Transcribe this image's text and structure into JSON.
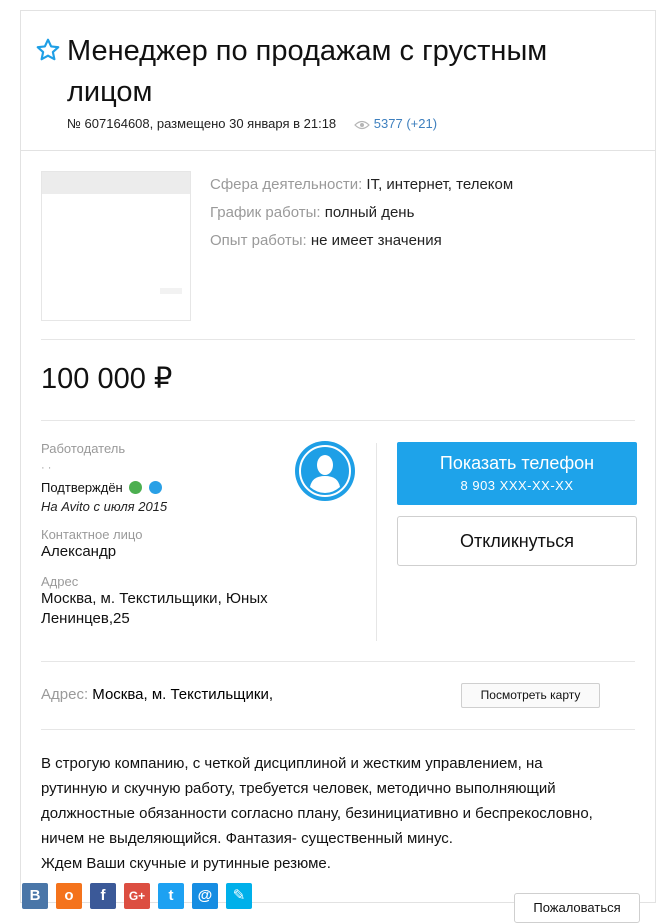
{
  "listing": {
    "title": "Менеджер по продажам с грустным лицом",
    "meta": "№ 607164608, размещено 30 января в 21:18",
    "views": "5377 (+21)"
  },
  "details": [
    {
      "label": "Сфера деятельности:",
      "value": "IT, интернет, телеком"
    },
    {
      "label": "График работы:",
      "value": "полный день"
    },
    {
      "label": "Опыт работы:",
      "value": "не имеет значения"
    }
  ],
  "price": "100 000 ₽",
  "seller": {
    "employer_label": "Работодатель",
    "confirmed": "Подтверждён",
    "since": "На Avito с июля 2015",
    "contact_label": "Контактное лицо",
    "contact_name": "Александр",
    "address_label": "Адрес",
    "address_line1": "Москва, м. Текстильщики, Юных",
    "address_line2": "Ленинцев,25"
  },
  "actions": {
    "show_phone": "Показать телефон",
    "phone_masked": "8 903 XXX-XX-XX",
    "respond": "Откликнуться",
    "show_map": "Посмотреть карту",
    "complain": "Пожаловаться"
  },
  "address_row": {
    "label": "Адрес:",
    "value": "Москва, м. Текстильщики,"
  },
  "description": [
    "В строгую компанию, с четкой дисциплиной и жестким управлением, на",
    "рутинную и скучную работу, требуется человек, методично выполняющий",
    "должностные обязанности согласно плану, безинициативно и беспрекословно,",
    "ничем не выделяющийся. Фантазия- существенный минус.",
    "Ждем Ваши скучные и рутинные резюме."
  ],
  "share": [
    {
      "name": "vk-icon",
      "glyph": "В",
      "color": "#4a76a8"
    },
    {
      "name": "odnoklassniki-icon",
      "glyph": "о",
      "color": "#f4731c"
    },
    {
      "name": "facebook-icon",
      "glyph": "f",
      "color": "#3b5998"
    },
    {
      "name": "google-plus-icon",
      "glyph": "G+",
      "color": "#dc4e41"
    },
    {
      "name": "twitter-icon",
      "glyph": "t",
      "color": "#1da1f2"
    },
    {
      "name": "mail-ru-icon",
      "glyph": "@",
      "color": "#168de2"
    },
    {
      "name": "livejournal-icon",
      "glyph": "✎",
      "color": "#00b0ea"
    }
  ],
  "colors": {
    "accent": "#1ea3ea",
    "link": "#3d7fbe",
    "muted": "#9a9a9a"
  }
}
